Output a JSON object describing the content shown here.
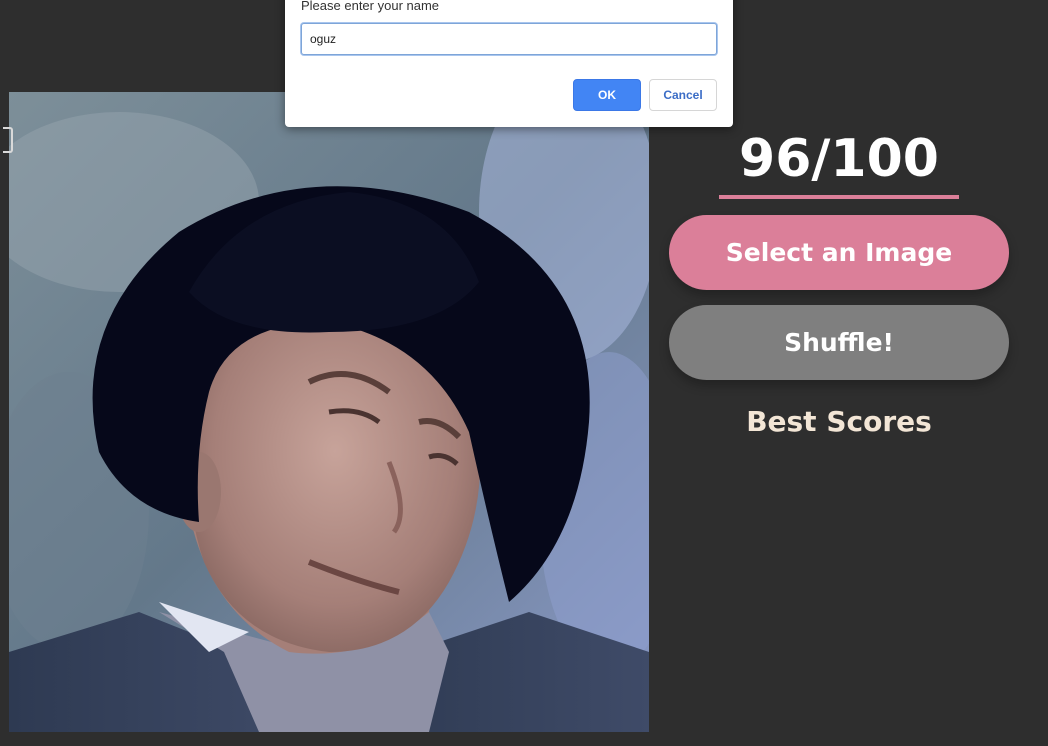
{
  "game": {
    "score": "96/100",
    "select_image_label": "Select an Image",
    "shuffle_label": "Shuffle!",
    "best_scores_title": "Best Scores",
    "image_subject": "photo of a man wearing a black hat",
    "colors": {
      "background": "#2e2e2e",
      "accent_pink": "#db7f99",
      "shuffle_gray": "#7f7f7f",
      "best_scores_text": "#f3e6d6"
    }
  },
  "prompt_dialog": {
    "message": "Please enter your name",
    "input_value": "oguz",
    "ok_label": "OK",
    "cancel_label": "Cancel",
    "ok_color": "#4285f4"
  }
}
